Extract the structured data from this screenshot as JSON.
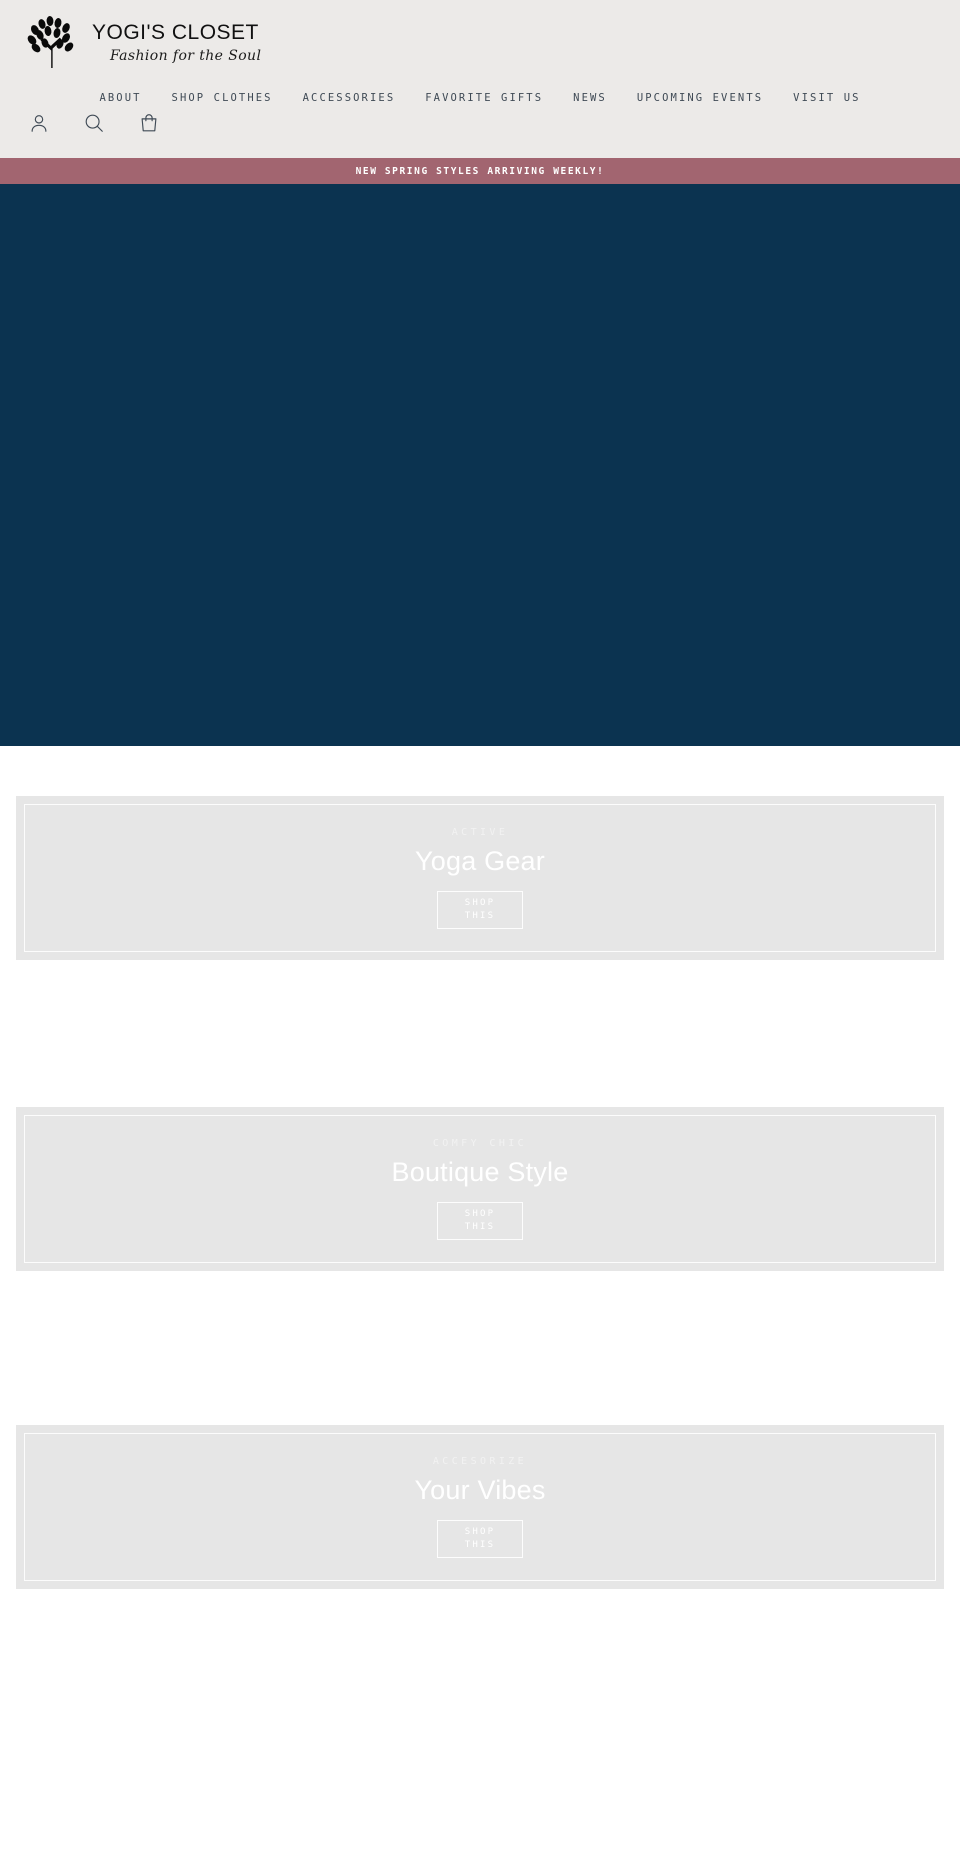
{
  "colors": {
    "header_bg": "#eceae8",
    "promo_bg": "#a26570",
    "hero_bg": "#0b3350",
    "card_bg": "#e6e6e6",
    "nav_text": "#3f4a55",
    "accent_white": "#ffffff"
  },
  "header": {
    "brand_name": "YOGI'S CLOSET",
    "brand_tagline": "Fashion for the Soul",
    "logo_icon": "tree-logo-icon",
    "nav": [
      {
        "label": "ABOUT",
        "name": "nav-link-about"
      },
      {
        "label": "SHOP CLOTHES",
        "name": "nav-link-shop-clothes"
      },
      {
        "label": "ACCESSORIES",
        "name": "nav-link-accessories"
      },
      {
        "label": "FAVORITE GIFTS",
        "name": "nav-link-favorite-gifts"
      },
      {
        "label": "NEWS",
        "name": "nav-link-news"
      },
      {
        "label": "UPCOMING EVENTS",
        "name": "nav-link-upcoming-events"
      },
      {
        "label": "VISIT US",
        "name": "nav-link-visit-us"
      }
    ],
    "icons": [
      {
        "name": "account-icon",
        "label": "Account"
      },
      {
        "name": "search-icon",
        "label": "Search"
      },
      {
        "name": "cart-icon",
        "label": "Cart"
      }
    ]
  },
  "promo": {
    "text": "NEW SPRING STYLES ARRIVING WEEKLY!"
  },
  "hero": {
    "background_color": "#0b3350"
  },
  "cards": [
    {
      "overline": "ACTIVE",
      "title": "Yoga Gear",
      "cta_line1": "SHOP",
      "cta_line2": "THIS",
      "name": "category-card-yoga-gear"
    },
    {
      "overline": "COMFY CHIC",
      "title": "Boutique Style",
      "cta_line1": "SHOP",
      "cta_line2": "THIS",
      "name": "category-card-boutique-style"
    },
    {
      "overline": "ACCESORIZE",
      "title": "Your Vibes",
      "cta_line1": "SHOP",
      "cta_line2": "THIS",
      "name": "category-card-your-vibes"
    }
  ]
}
